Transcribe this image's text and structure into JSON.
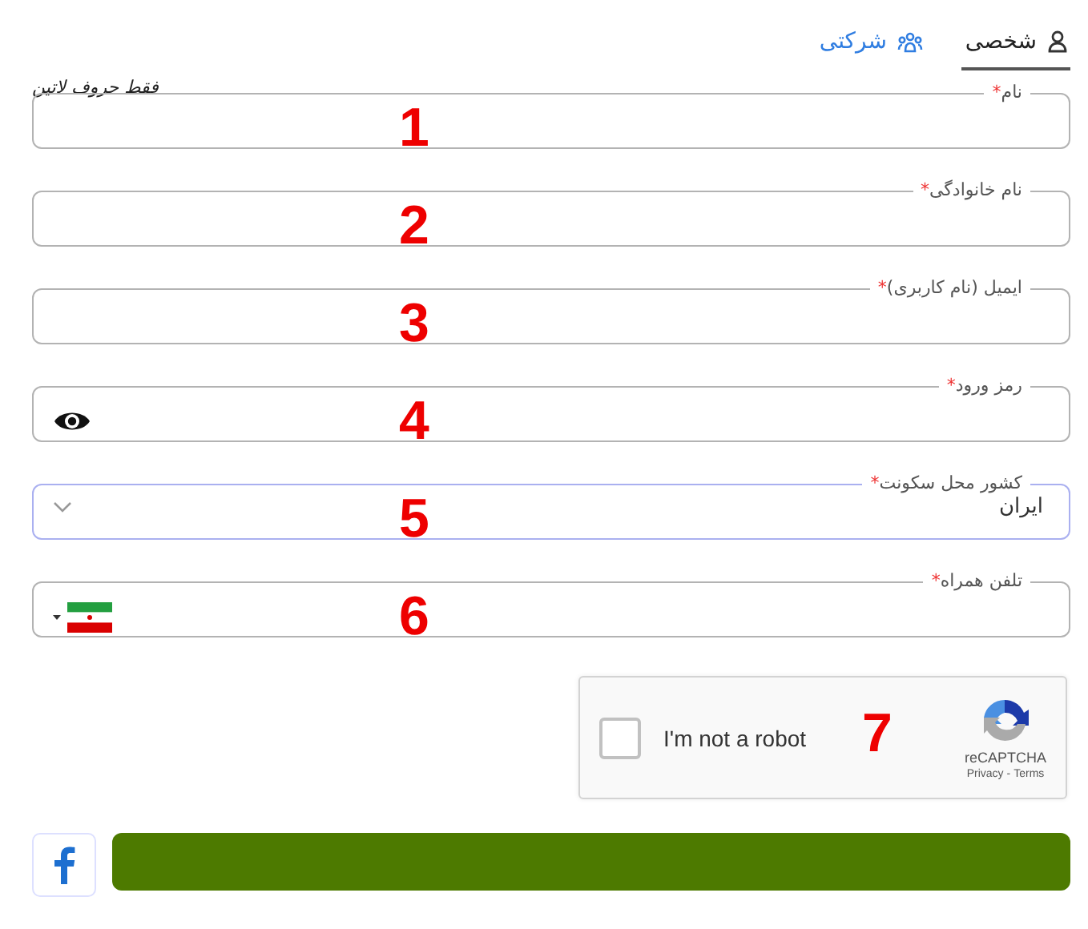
{
  "tabs": [
    {
      "label": "شخصی",
      "kind": "person",
      "selected": true
    },
    {
      "label": "شرکتی",
      "kind": "group",
      "selected": false
    }
  ],
  "hint": "فقط حروف لاتین",
  "fields": [
    {
      "label": "نام",
      "asterisk": "*",
      "kind": "text",
      "marker": "1"
    },
    {
      "label": "نام خانوادگی",
      "asterisk": "*",
      "kind": "text",
      "marker": "2"
    },
    {
      "label": "ایمیل (نام کاربری)",
      "asterisk": "*",
      "kind": "text",
      "marker": "3"
    },
    {
      "label": "رمز ورود",
      "asterisk": "*",
      "kind": "password",
      "marker": "4"
    },
    {
      "label": "کشور محل سکونت",
      "asterisk": "*",
      "kind": "select",
      "value": "ایران",
      "marker": "5"
    },
    {
      "label": "تلفن همراه",
      "asterisk": "*",
      "kind": "phone",
      "marker": "6"
    }
  ],
  "captcha": {
    "label": "I'm not a robot",
    "checked": false,
    "brand": "reCAPTCHA",
    "privacy": "Privacy",
    "separator": "-",
    "terms": "Terms",
    "marker": "7"
  }
}
